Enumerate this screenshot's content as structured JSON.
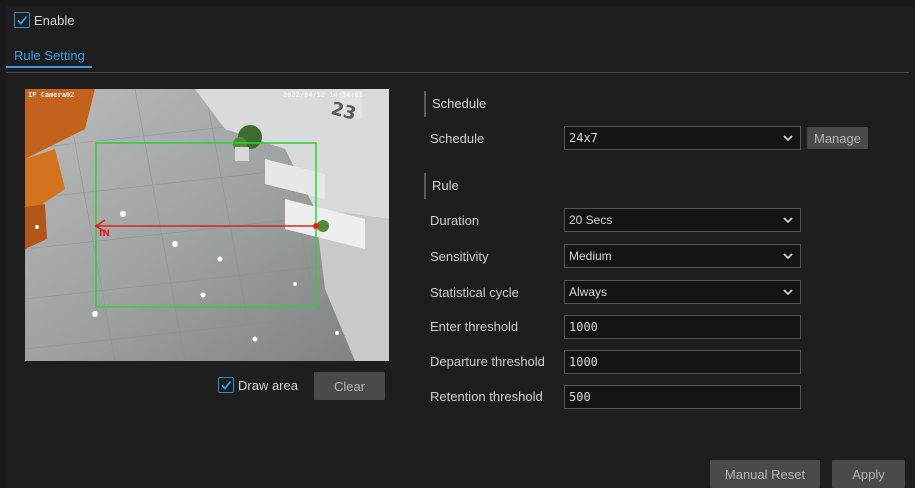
{
  "enable": {
    "label": "Enable",
    "checked": true
  },
  "tabs": [
    {
      "label": "Rule Setting",
      "active": true
    }
  ],
  "preview": {
    "camera_name": "IP Camera02",
    "timestamp": "2022/04/12 14:34:01",
    "wall_number": "23",
    "line_label": "IN",
    "draw_area": {
      "label": "Draw area",
      "checked": true
    },
    "clear_label": "Clear"
  },
  "schedule": {
    "section_title": "Schedule",
    "label": "Schedule",
    "value": "24x7",
    "manage_label": "Manage"
  },
  "rule": {
    "section_title": "Rule",
    "duration": {
      "label": "Duration",
      "value": "20 Secs"
    },
    "sensitivity": {
      "label": "Sensitivity",
      "value": "Medium"
    },
    "statistical_cycle": {
      "label": "Statistical cycle",
      "value": "Always"
    },
    "enter_threshold": {
      "label": "Enter threshold",
      "value": "1000"
    },
    "departure_threshold": {
      "label": "Departure threshold",
      "value": "1000"
    },
    "retention_threshold": {
      "label": "Retention threshold",
      "value": "500"
    }
  },
  "footer": {
    "manual_reset_label": "Manual Reset",
    "apply_label": "Apply"
  },
  "colors": {
    "accent": "#3b9be6",
    "area_box": "#2fd12f",
    "line": "#e02020"
  }
}
